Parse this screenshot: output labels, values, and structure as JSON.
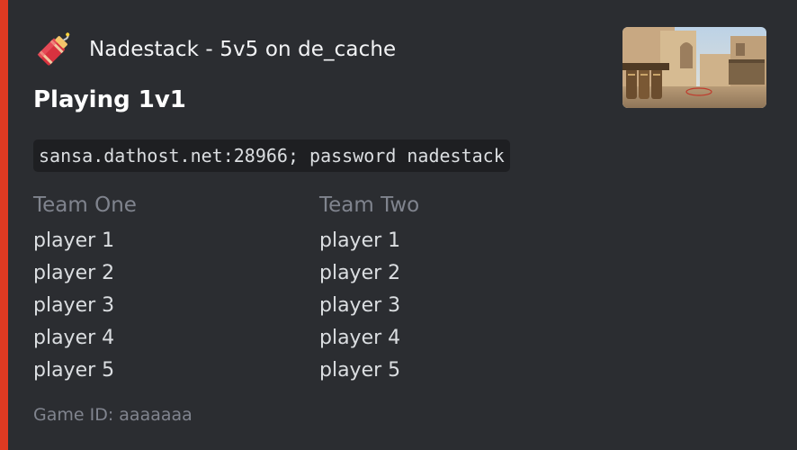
{
  "embed": {
    "accent_color": "#e03a22",
    "author": {
      "icon": "firecracker-icon",
      "name": "Nadestack - 5v5 on de_cache"
    },
    "thumbnail": "de_cache-map-thumbnail",
    "title": "Playing 1v1",
    "connect_command": "sansa.dathost.net:28966; password nadestack",
    "fields": [
      {
        "name": "Team One",
        "players": [
          "player 1",
          "player 2",
          "player 3",
          "player 4",
          "player 5"
        ]
      },
      {
        "name": "Team Two",
        "players": [
          "player 1",
          "player 2",
          "player 3",
          "player 4",
          "player 5"
        ]
      }
    ],
    "footer": "Game ID: aaaaaaa"
  }
}
